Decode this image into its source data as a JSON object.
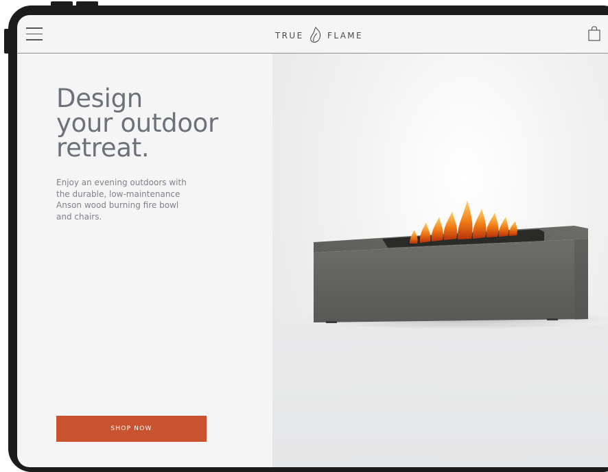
{
  "header": {
    "menu_icon": "hamburger-menu-icon",
    "logo_left": "TRUE",
    "logo_right": "FLAME",
    "logo_icon": "flame-icon",
    "bag_icon": "shopping-bag-icon"
  },
  "hero": {
    "title_lines": [
      "Design",
      "your outdoor",
      "retreat."
    ],
    "description_lines": [
      "Enjoy an evening outdoors with",
      "the durable, low-maintenance",
      "Anson wood burning fire bowl",
      "and chairs."
    ],
    "cta_label": "SHOP NOW",
    "cta_color": "#c9532f",
    "image_subject": "square-concrete-fire-table-with-flames"
  },
  "colors": {
    "background": "#f6f5f6",
    "title": "#6d717a",
    "frame": "#1c1c1c"
  }
}
